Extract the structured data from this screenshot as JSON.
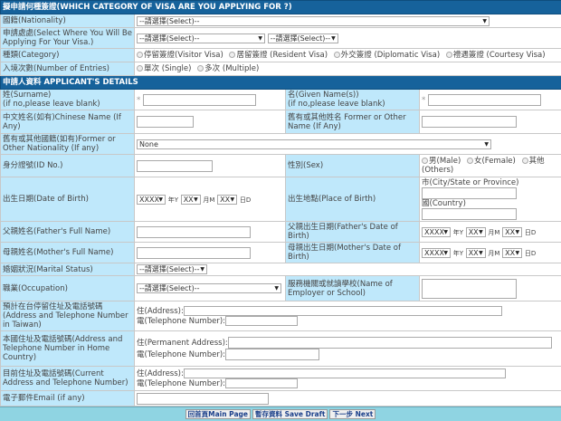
{
  "section1": {
    "title": "擬申請何種簽證(WHICH CATEGORY OF VISA ARE YOU APPLYING FOR ?)",
    "nationality_label": "國籍(Nationality)",
    "nationality_value": "--請選擇(Select)--",
    "location_label": "申請處處(Select Where You Will Be Applying For Your Visa.)",
    "location_value1": "--請選擇(Select)--",
    "location_value2": "--請選擇(Select)--",
    "category_label": "種類(Category)",
    "category_options": [
      "停留簽證(Visitor Visa)",
      "居留簽證 (Resident Visa)",
      "外交簽證 (Diplomatic Visa)",
      "禮遇簽證 (Courtesy Visa)"
    ],
    "entries_label": "入境次數(Number of Entries)",
    "entries_options": [
      "單次 (Single)",
      "多次 (Multiple)"
    ]
  },
  "section2": {
    "title": "申請人資料 APPLICANT'S DETAILS",
    "required_mark": "*",
    "surname_label": "姓(Surname)",
    "surname_note": "(if no,please leave blank)",
    "given_label": "名(Given Name(s))",
    "given_note": "(if no,please leave blank)",
    "chinese_name_label": "中文姓名(如有)Chinese Name (If Any)",
    "former_name_label": "舊有或其他姓名 Former or Other Name (If Any)",
    "former_nationality_label": "舊有或其他國籍(如有)Former or Other Nationality (If any)",
    "former_nationality_value": "None",
    "id_label": "身分證號(ID No.)",
    "sex_label": "性別(Sex)",
    "sex_options": [
      "男(Male)",
      "女(Female)",
      "其他 (Others)"
    ],
    "dob_label": "出生日期(Date of Birth)",
    "year_placeholder": "XXXX",
    "md_placeholder": "XX",
    "year_unit": "年Y",
    "month_unit": "月M",
    "day_unit": "日D",
    "pob_label": "出生地點(Place of Birth)",
    "city_label": "市(City/State or Province)",
    "country_label": "國(Country)",
    "father_name_label": "父親姓名(Father's Full Name)",
    "father_dob_label": "父親出生日期(Father's Date of Birth)",
    "mother_name_label": "母親姓名(Mother's Full Name)",
    "mother_dob_label": "母親出生日期(Mother's Date of Birth)",
    "marital_label": "婚姻狀況(Marital Status)",
    "marital_value": "--請選擇(Select)--",
    "occupation_label": "職業(Occupation)",
    "occupation_value": "--請選擇(Select)--",
    "employer_label": "服務機關或就讀學校(Name of Employer or School)",
    "taiwan_addr_label": "預計在台停留住址及電話號碼(Address and Telephone Number in Taiwan)",
    "address_label": "住(Address):",
    "tel_label": "電(Telephone Number):",
    "home_addr_label": "本國住址及電話號碼(Address and Telephone Number in Home Country)",
    "perm_address_label": "住(Permanent Address):",
    "current_addr_label": "目前住址及電話號碼(Current Address and Telephone Number)",
    "email_label": "電子郵件Email (if any)"
  },
  "footer": {
    "main_page": "回首頁Main Page",
    "save_draft": "暫存資料 Save Draft",
    "next": "下一步 Next"
  }
}
